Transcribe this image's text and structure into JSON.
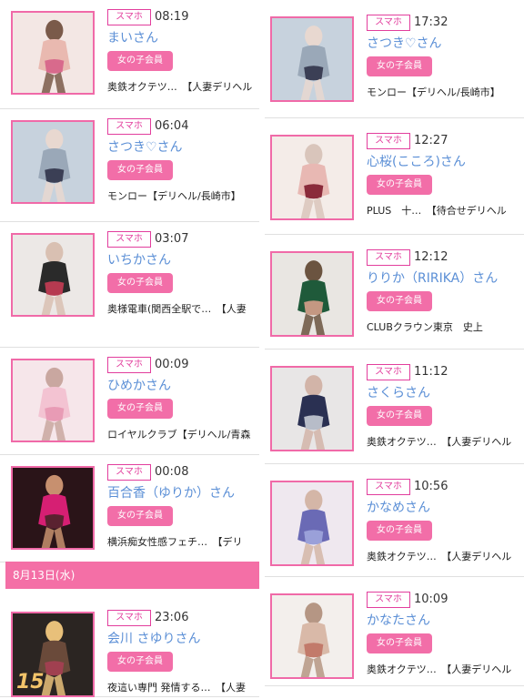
{
  "left": [
    {
      "badge": "スマホ",
      "time": "08:19",
      "name": "まいさん",
      "member": "女の子会員",
      "shop": "奥鉄オクテツ…　【人妻デリヘル",
      "img": "pink"
    },
    {
      "badge": "スマホ",
      "time": "06:04",
      "name": "さつき♡さん",
      "member": "女の子会員",
      "shop": "モンロー【デリヘル/長崎市】",
      "img": "lingerie"
    },
    {
      "badge": "スマホ",
      "time": "03:07",
      "name": "いちかさん",
      "member": "女の子会員",
      "shop": "奥様電車(関西全駅で…　【人妻",
      "img": "legs"
    },
    {
      "badge": "スマホ",
      "time": "00:09",
      "name": "ひめかさん",
      "member": "女の子会員",
      "shop": "ロイヤルクラブ【デリヘル/青森",
      "img": "bed"
    },
    {
      "badge": "スマホ",
      "time": "00:08",
      "name": "百合香（ゆりか）さん",
      "member": "女の子会員",
      "shop": "横浜痴女性感フェチ…　【デリ",
      "img": "red"
    }
  ],
  "date_bar": "8月13日(水)",
  "left_last": {
    "badge": "スマホ",
    "time": "23:06",
    "name": "会川 さゆりさん",
    "member": "女の子会員",
    "shop": "夜這い専門 発情する…　【人妻",
    "img": "dark",
    "overlay": "15"
  },
  "right": [
    {
      "badge": "スマホ",
      "time": "17:32",
      "name": "さつき♡さん",
      "member": "女の子会員",
      "shop": "モンロー【デリヘル/長崎市】",
      "img": "lingerie"
    },
    {
      "badge": "スマホ",
      "time": "12:27",
      "name": "心桜(こころ)さん",
      "member": "女の子会員",
      "shop": "PLUS　十…　【待合せデリヘル",
      "img": "dress"
    },
    {
      "badge": "スマホ",
      "time": "12:12",
      "name": "りりか（RIRIKA）さん",
      "member": "女の子会員",
      "shop": "CLUBクラウン東京　史上",
      "img": "green"
    },
    {
      "badge": "スマホ",
      "time": "11:12",
      "name": "さくらさん",
      "member": "女の子会員",
      "shop": "奥鉄オクテツ…　【人妻デリヘル",
      "img": "navy"
    },
    {
      "badge": "スマホ",
      "time": "10:56",
      "name": "かなめさん",
      "member": "女の子会員",
      "shop": "奥鉄オクテツ…　【人妻デリヘル",
      "img": "purple"
    },
    {
      "badge": "スマホ",
      "time": "10:09",
      "name": "かなたさん",
      "member": "女の子会員",
      "shop": "奥鉄オクテツ…　【人妻デリヘル",
      "img": "beige"
    }
  ]
}
